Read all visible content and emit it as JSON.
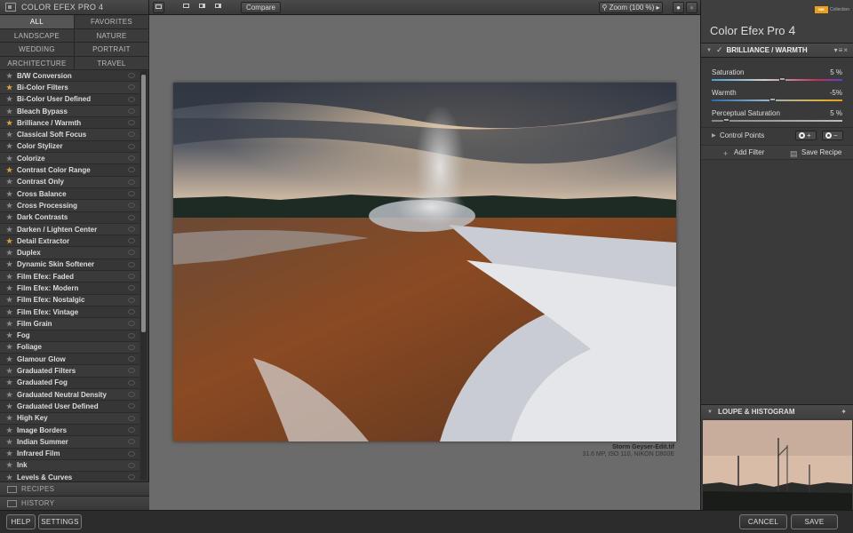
{
  "app": {
    "title": "COLOR EFEX PRO 4"
  },
  "categories": [
    {
      "label": "ALL",
      "active": true
    },
    {
      "label": "FAVORITES"
    },
    {
      "label": "LANDSCAPE"
    },
    {
      "label": "NATURE"
    },
    {
      "label": "WEDDING"
    },
    {
      "label": "PORTRAIT"
    },
    {
      "label": "ARCHITECTURE"
    },
    {
      "label": "TRAVEL"
    }
  ],
  "filters": [
    {
      "label": "B/W Conversion",
      "fav": false
    },
    {
      "label": "Bi-Color Filters",
      "fav": true
    },
    {
      "label": "Bi-Color User Defined",
      "fav": false
    },
    {
      "label": "Bleach Bypass",
      "fav": false
    },
    {
      "label": "Brilliance / Warmth",
      "fav": true
    },
    {
      "label": "Classical Soft Focus",
      "fav": false
    },
    {
      "label": "Color Stylizer",
      "fav": false
    },
    {
      "label": "Colorize",
      "fav": false
    },
    {
      "label": "Contrast Color Range",
      "fav": true
    },
    {
      "label": "Contrast Only",
      "fav": false
    },
    {
      "label": "Cross Balance",
      "fav": false
    },
    {
      "label": "Cross Processing",
      "fav": false
    },
    {
      "label": "Dark Contrasts",
      "fav": false
    },
    {
      "label": "Darken / Lighten Center",
      "fav": false
    },
    {
      "label": "Detail Extractor",
      "fav": true
    },
    {
      "label": "Duplex",
      "fav": false
    },
    {
      "label": "Dynamic Skin Softener",
      "fav": false
    },
    {
      "label": "Film Efex: Faded",
      "fav": false
    },
    {
      "label": "Film Efex: Modern",
      "fav": false
    },
    {
      "label": "Film Efex: Nostalgic",
      "fav": false
    },
    {
      "label": "Film Efex: Vintage",
      "fav": false
    },
    {
      "label": "Film Grain",
      "fav": false
    },
    {
      "label": "Fog",
      "fav": false
    },
    {
      "label": "Foliage",
      "fav": false
    },
    {
      "label": "Glamour Glow",
      "fav": false
    },
    {
      "label": "Graduated Filters",
      "fav": false
    },
    {
      "label": "Graduated Fog",
      "fav": false
    },
    {
      "label": "Graduated Neutral Density",
      "fav": false
    },
    {
      "label": "Graduated User Defined",
      "fav": false
    },
    {
      "label": "High Key",
      "fav": false
    },
    {
      "label": "Image Borders",
      "fav": false
    },
    {
      "label": "Indian Summer",
      "fav": false
    },
    {
      "label": "Infrared Film",
      "fav": false
    },
    {
      "label": "Ink",
      "fav": false
    },
    {
      "label": "Levels & Curves",
      "fav": false
    }
  ],
  "sections": {
    "recipes": "RECIPES",
    "history": "HISTORY"
  },
  "toolbar": {
    "compare": "Compare",
    "zoom": "Zoom (100 %)"
  },
  "image": {
    "filename": "Storm Geyser-Edit.tif",
    "info": "31.6 MP, ISO 110, NIKON D800E"
  },
  "right": {
    "brand": "Color Efex Pro",
    "version": "4",
    "badge": "NIK",
    "collection": "Collection",
    "filter_name": "BRILLIANCE / WARMTH",
    "sliders": [
      {
        "label": "Saturation",
        "value": "5 %",
        "level": 0.54
      },
      {
        "label": "Warmth",
        "value": "-5%",
        "level": 0.46
      },
      {
        "label": "Perceptual Saturation",
        "value": "5 %",
        "level": 0.09
      }
    ],
    "control_points": "Control Points",
    "add_filter": "Add Filter",
    "save_recipe": "Save Recipe",
    "loupe": "LOUPE & HISTOGRAM"
  },
  "bottom": {
    "help": "HELP",
    "settings": "SETTINGS",
    "cancel": "CANCEL",
    "save": "SAVE"
  }
}
